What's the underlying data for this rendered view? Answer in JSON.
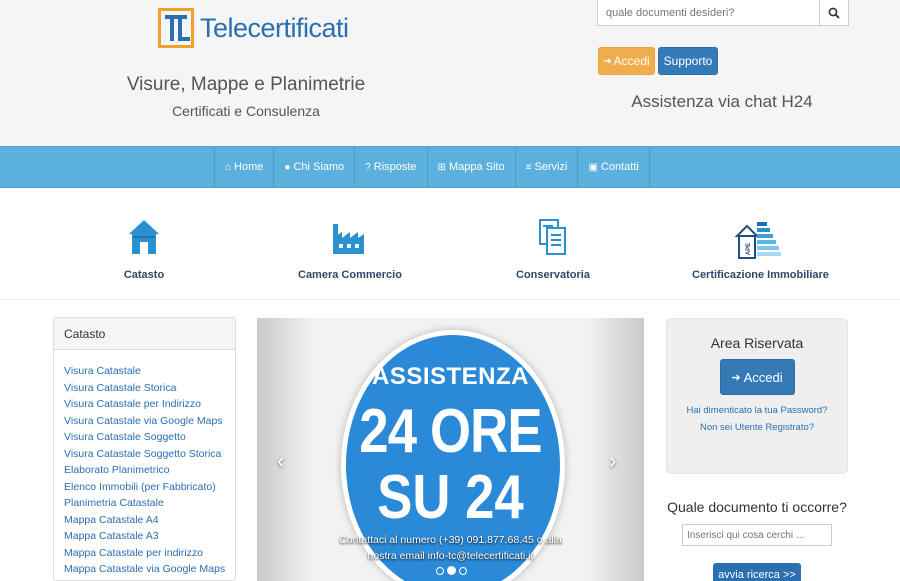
{
  "header": {
    "logo_text": "Telecertificati",
    "tagline_main": "Visure, Mappe e Planimetrie",
    "tagline_sub": "Certificati e Consulenza",
    "search_placeholder": "quale documenti desideri?",
    "login_label": "Accedi",
    "support_label": "Supporto",
    "chat_text": "Assistenza via chat H24"
  },
  "nav": {
    "items": [
      {
        "label": "Home",
        "icon": "home-icon"
      },
      {
        "label": "Chi Siamo",
        "icon": "user-icon"
      },
      {
        "label": "Risposte",
        "icon": "question-icon"
      },
      {
        "label": "Mappa Sito",
        "icon": "sitemap-icon"
      },
      {
        "label": "Servizi",
        "icon": "list-icon"
      },
      {
        "label": "Contatti",
        "icon": "briefcase-icon"
      }
    ]
  },
  "categories": [
    {
      "label": "Catasto",
      "icon": "house-icon"
    },
    {
      "label": "Camera Commercio",
      "icon": "factory-icon"
    },
    {
      "label": "Conservatoria",
      "icon": "documents-icon"
    },
    {
      "label": "Certificazione Immobiliare",
      "icon": "ape-building-icon"
    }
  ],
  "sidebar": {
    "title": "Catasto",
    "links": [
      "Visura Catastale",
      "Visura Catastale Storica",
      "Visura Catastale per Indirizzo",
      "Visura Catastale via Google Maps",
      "Visura Catastale Soggetto",
      "Visura Catastale Soggetto Storica",
      "Elaborato Planimetrico",
      "Elenco Immobili (per Fabbricato)",
      "Planimetria Catastale",
      "Mappa Catastale A4",
      "Mappa Catastale A3",
      "Mappa Catastale per indirizzo",
      "Mappa Catastale via Google Maps"
    ]
  },
  "carousel": {
    "top": "ASSISTENZA",
    "middle": "24 ORE",
    "bottom": "SU 24",
    "caption_line1": "Contattaci al numero (+39) 091.877.68.45 o alla",
    "caption_line2": "nostra email info-tc@telecertificati.it",
    "prev": "‹",
    "next": "›"
  },
  "area": {
    "title": "Area Riservata",
    "login_label": "Accedi",
    "forgot_password": "Hai dimenticato la tua Password?",
    "not_registered": "Non sei Utente Registrato?"
  },
  "query": {
    "title": "Quale documento ti occorre?",
    "placeholder": "Inserisci qui cosa cerchi ...",
    "button": "avvia ricerca >>"
  },
  "colors": {
    "navbar": "#5bb0de",
    "brand_blue": "#2a6fb0",
    "login_orange": "#f0ad4e",
    "support_blue": "#337ab7"
  }
}
